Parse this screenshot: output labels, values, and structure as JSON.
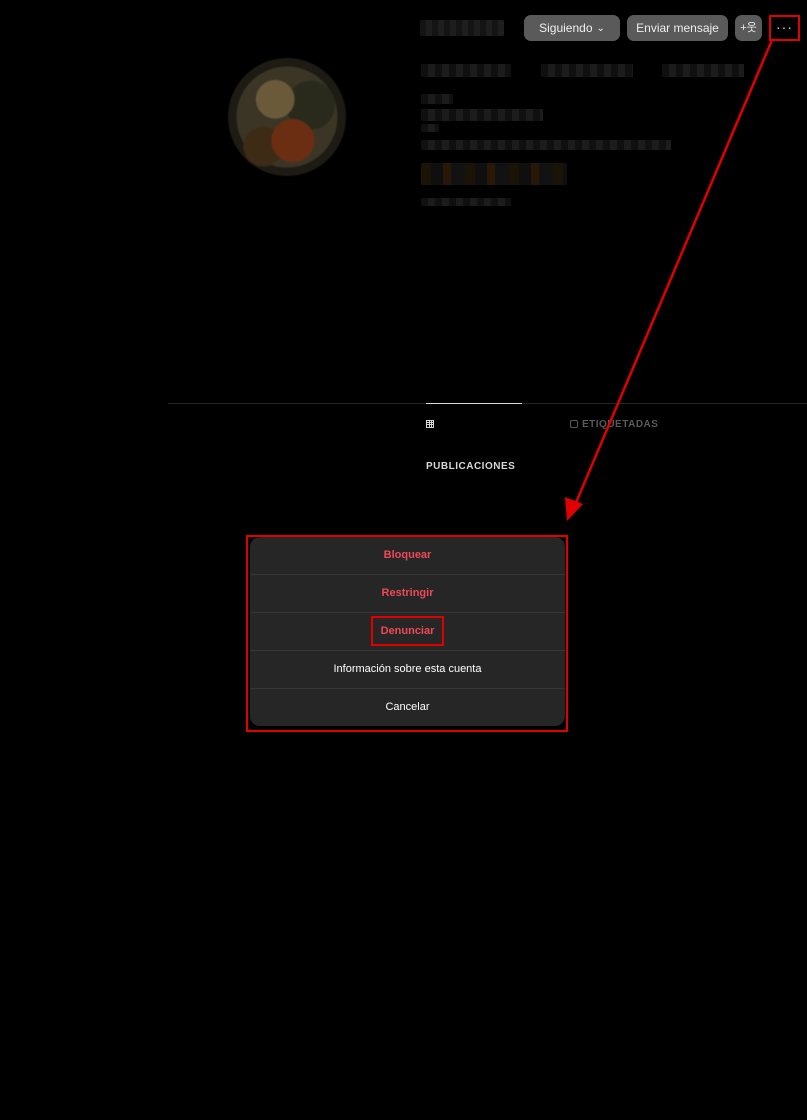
{
  "header": {
    "following_label": "Siguiendo",
    "message_label": "Enviar mensaje",
    "add_user_label": "+웃",
    "more_label": "···"
  },
  "tabs": [
    {
      "label": "PUBLICACIONES",
      "selected": true,
      "icon": "grid-icon"
    },
    {
      "label": "ETIQUETADAS",
      "selected": false,
      "icon": "tag-person-icon"
    }
  ],
  "menu": {
    "items": [
      {
        "label": "Bloquear",
        "danger": true
      },
      {
        "label": "Restringir",
        "danger": true
      },
      {
        "label": "Denunciar",
        "danger": true
      },
      {
        "label": "Información sobre esta cuenta",
        "danger": false
      },
      {
        "label": "Cancelar",
        "danger": false
      }
    ]
  },
  "colors": {
    "background": "#000000",
    "button": "#5a5a5a",
    "modal": "#262626",
    "danger": "#ed4956",
    "annotation": "#e00000"
  }
}
